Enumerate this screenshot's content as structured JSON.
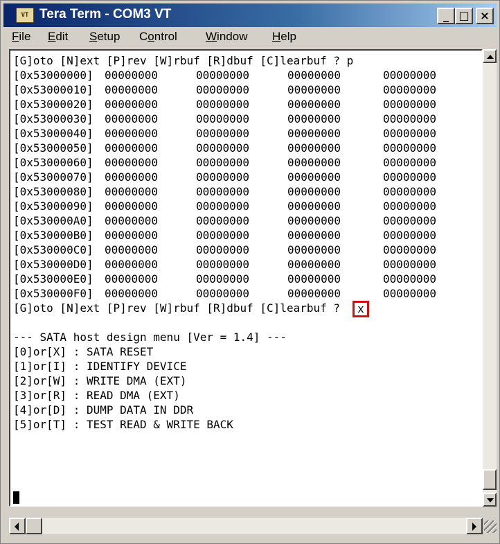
{
  "window": {
    "title": "Tera Term - COM3 VT",
    "controls": [
      "_",
      "□",
      "×"
    ]
  },
  "menu": [
    {
      "mnemonic": "F",
      "rest": "ile"
    },
    {
      "mnemonic": "E",
      "rest": "dit"
    },
    {
      "mnemonic": "S",
      "rest": "etup"
    },
    {
      "pre": "C",
      "mnemonic": "o",
      "rest": "ntrol"
    },
    {
      "mnemonic": "W",
      "rest": "indow"
    },
    {
      "mnemonic": "H",
      "rest": "elp"
    }
  ],
  "terminal": {
    "prompt_line_1": "[G]oto [N]ext [P]rev [W]rbuf [R]dbuf [C]learbuf ? p",
    "dump": [
      {
        "addr": "[0x53000000]",
        "vals": [
          "00000000",
          "00000000",
          "00000000",
          "00000000"
        ]
      },
      {
        "addr": "[0x53000010]",
        "vals": [
          "00000000",
          "00000000",
          "00000000",
          "00000000"
        ]
      },
      {
        "addr": "[0x53000020]",
        "vals": [
          "00000000",
          "00000000",
          "00000000",
          "00000000"
        ]
      },
      {
        "addr": "[0x53000030]",
        "vals": [
          "00000000",
          "00000000",
          "00000000",
          "00000000"
        ]
      },
      {
        "addr": "[0x53000040]",
        "vals": [
          "00000000",
          "00000000",
          "00000000",
          "00000000"
        ]
      },
      {
        "addr": "[0x53000050]",
        "vals": [
          "00000000",
          "00000000",
          "00000000",
          "00000000"
        ]
      },
      {
        "addr": "[0x53000060]",
        "vals": [
          "00000000",
          "00000000",
          "00000000",
          "00000000"
        ]
      },
      {
        "addr": "[0x53000070]",
        "vals": [
          "00000000",
          "00000000",
          "00000000",
          "00000000"
        ]
      },
      {
        "addr": "[0x53000080]",
        "vals": [
          "00000000",
          "00000000",
          "00000000",
          "00000000"
        ]
      },
      {
        "addr": "[0x53000090]",
        "vals": [
          "00000000",
          "00000000",
          "00000000",
          "00000000"
        ]
      },
      {
        "addr": "[0x530000A0]",
        "vals": [
          "00000000",
          "00000000",
          "00000000",
          "00000000"
        ]
      },
      {
        "addr": "[0x530000B0]",
        "vals": [
          "00000000",
          "00000000",
          "00000000",
          "00000000"
        ]
      },
      {
        "addr": "[0x530000C0]",
        "vals": [
          "00000000",
          "00000000",
          "00000000",
          "00000000"
        ]
      },
      {
        "addr": "[0x530000D0]",
        "vals": [
          "00000000",
          "00000000",
          "00000000",
          "00000000"
        ]
      },
      {
        "addr": "[0x530000E0]",
        "vals": [
          "00000000",
          "00000000",
          "00000000",
          "00000000"
        ]
      },
      {
        "addr": "[0x530000F0]",
        "vals": [
          "00000000",
          "00000000",
          "00000000",
          "00000000"
        ]
      }
    ],
    "prompt_line_2": "[G]oto [N]ext [P]rev [W]rbuf [R]dbuf [C]learbuf ? ",
    "typed_input": "x",
    "highlight_color": "#cc1111",
    "blank_line": "",
    "menu_lines": [
      "--- SATA host design menu [Ver = 1.4] ---",
      "[0]or[X] : SATA RESET",
      "[1]or[I] : IDENTIFY DEVICE",
      "[2]or[W] : WRITE DMA (EXT)",
      "[3]or[R] : READ DMA (EXT)",
      "[4]or[D] : DUMP DATA IN DDR",
      "[5]or[T] : TEST READ & WRITE BACK"
    ]
  }
}
